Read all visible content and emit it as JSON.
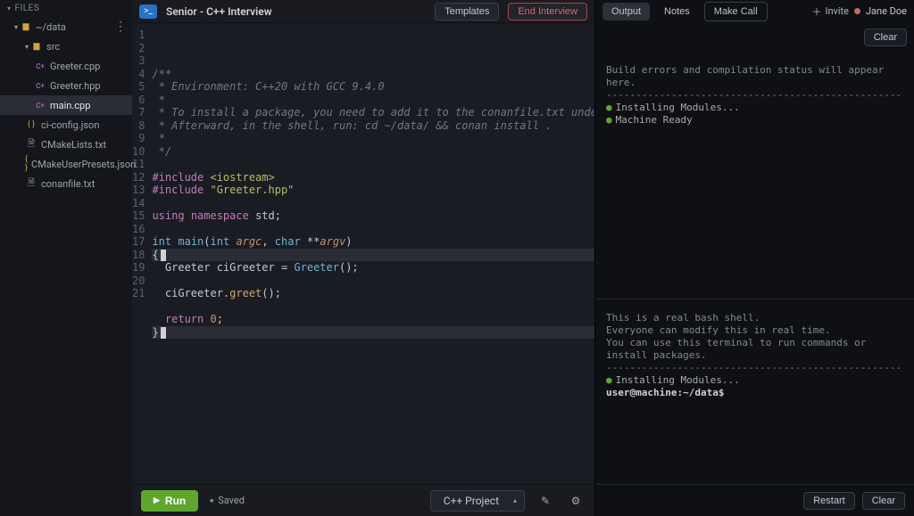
{
  "sidebar": {
    "title": "FILES",
    "root": "~/data",
    "folders": [
      {
        "name": "src"
      }
    ],
    "srcFiles": [
      {
        "name": "Greeter.cpp",
        "active": false
      },
      {
        "name": "Greeter.hpp",
        "active": false
      },
      {
        "name": "main.cpp",
        "active": true
      }
    ],
    "rootFiles": [
      {
        "name": "ci-config.json",
        "icon": "json"
      },
      {
        "name": "CMakeLists.txt",
        "icon": "txt"
      },
      {
        "name": "CMakeUserPresets.json",
        "icon": "json"
      },
      {
        "name": "conanfile.txt",
        "icon": "txt"
      }
    ]
  },
  "header": {
    "sessionTitle": "Senior - C++ Interview",
    "templatesLabel": "Templates",
    "endInterviewLabel": "End Interview"
  },
  "code": {
    "lines": [
      {
        "n": 1,
        "html": "<span class='c-comment'>/**</span>"
      },
      {
        "n": 2,
        "html": "<span class='c-comment'> * Environment: C++20 with GCC 9.4.0</span>"
      },
      {
        "n": 3,
        "html": "<span class='c-comment'> *</span>"
      },
      {
        "n": 4,
        "html": "<span class='c-comment'> * To install a package, you need to add it to the conanfile.txt under [requires]</span>"
      },
      {
        "n": 5,
        "html": "<span class='c-comment'> * Afterward, in the shell, run: cd ~/data/ &amp;&amp; conan install .</span>"
      },
      {
        "n": 6,
        "html": "<span class='c-comment'> *</span>"
      },
      {
        "n": 7,
        "html": "<span class='c-comment'> */</span>"
      },
      {
        "n": 8,
        "html": ""
      },
      {
        "n": 9,
        "html": "<span class='c-keyword'>#include</span> <span class='c-string'>&lt;iostream&gt;</span>"
      },
      {
        "n": 10,
        "html": "<span class='c-keyword'>#include</span> <span class='c-string'>\"Greeter.hpp\"</span>"
      },
      {
        "n": 11,
        "html": ""
      },
      {
        "n": 12,
        "html": "<span class='c-keyword'>using</span> <span class='c-keyword'>namespace</span> std;"
      },
      {
        "n": 13,
        "html": ""
      },
      {
        "n": 14,
        "html": "<span class='c-type'>int</span> <span class='c-func'>main</span>(<span class='c-type'>int</span> <span class='c-arg'>argc</span>, <span class='c-type'>char</span> **<span class='c-arg'>argv</span>)"
      },
      {
        "n": 15,
        "html": "{<span class='caret'></span>",
        "hl": true
      },
      {
        "n": 16,
        "html": "  Greeter ciGreeter = <span class='c-type'>Greeter</span>();"
      },
      {
        "n": 17,
        "html": ""
      },
      {
        "n": 18,
        "html": "  ciGreeter.<span class='c-call'>greet</span>();"
      },
      {
        "n": 19,
        "html": ""
      },
      {
        "n": 20,
        "html": "  <span class='c-keyword'>return</span> <span class='c-num'>0</span>;"
      },
      {
        "n": 21,
        "html": "}<span class='caret'></span>",
        "hl": true
      }
    ]
  },
  "footer": {
    "runLabel": "Run",
    "savedLabel": "Saved",
    "projectLabel": "C++ Project",
    "restartLabel": "Restart",
    "clearLabel": "Clear"
  },
  "rightPanel": {
    "tabs": {
      "output": "Output",
      "notes": "Notes",
      "makeCall": "Make Call"
    },
    "inviteLabel": "Invite",
    "username": "Jane Doe",
    "clearLabel": "Clear",
    "outputPlaceholder": "Build errors and compilation status will appear here.",
    "outputStatus": [
      "Installing Modules...",
      "Machine Ready"
    ],
    "terminalIntro": [
      "This is a real bash shell.",
      "Everyone can modify this in real time.",
      "You can use this terminal to run commands or install packages."
    ],
    "terminalStatus": "Installing Modules...",
    "terminalPrompt": "user@machine:~/data$"
  }
}
